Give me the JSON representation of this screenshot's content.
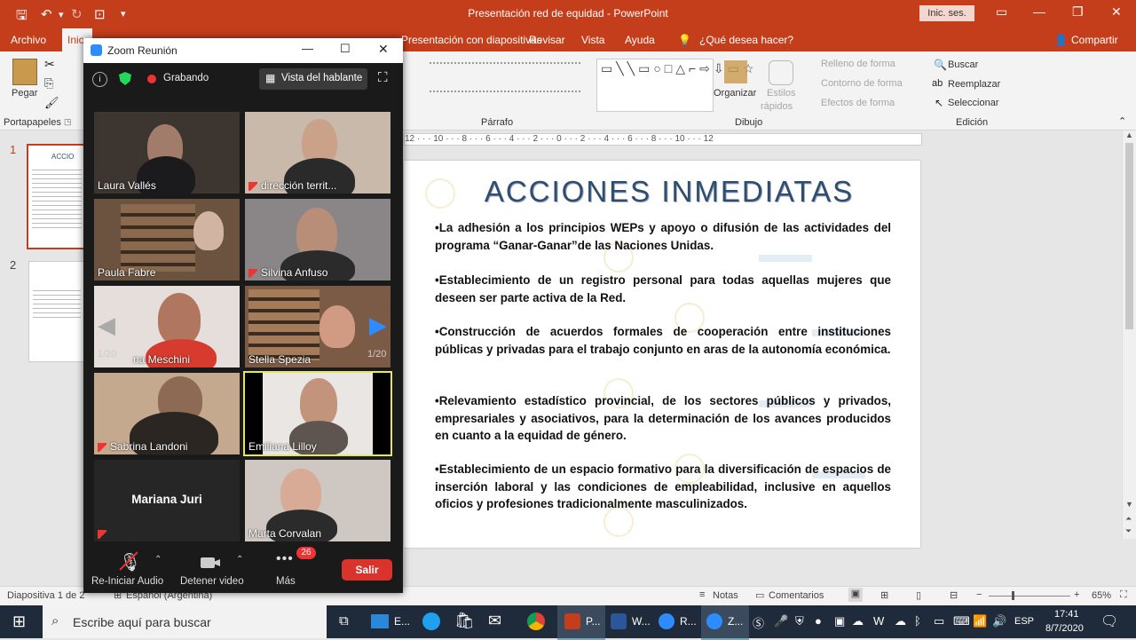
{
  "titlebar": {
    "title": "Presentación red de equidad  -  PowerPoint",
    "signin": "Inic. ses."
  },
  "tabs": [
    "Archivo",
    "Inic",
    "Presentación con diapositivas",
    "Revisar",
    "Vista",
    "Ayuda",
    "¿Qué desea hacer?",
    "Compartir"
  ],
  "ribbon": {
    "paste": "Pegar",
    "portapapeles": "Portapapeles",
    "parrafo": "Párrafo",
    "dibujo": "Dibujo",
    "edicion": "Edición",
    "organizar": "Organizar",
    "estilos1": "Estilos",
    "estilos2": "rápidos",
    "relleno": "Relleno de forma",
    "contorno": "Contorno de forma",
    "efectos": "Efectos de forma",
    "buscar": "Buscar",
    "reemplazar": "Reemplazar",
    "seleccionar": "Seleccionar"
  },
  "ruler": "12 · · · 10 · · · 8 · · · 6 · · · 4 · · · 2 · · · 0 · · · 2 · · · 4 · · · 6 · · · 8 · · · 10 · · · 12",
  "thumbs": {
    "n1": "1",
    "n2": "2",
    "t1": "ACCIO"
  },
  "slide": {
    "title": "ACCIONES INMEDIATAS",
    "bullets": [
      "•La adhesión a los principios WEPs y apoyo o difusión de las actividades del programa “Ganar-Ganar”de las Naciones Unidas.",
      "•Establecimiento de un registro personal para todas aquellas mujeres que deseen ser parte activa de la Red.",
      "•Construcción de acuerdos formales de cooperación entre instituciones públicas y privadas para el trabajo conjunto en aras de la autonomía económica.",
      "•Relevamiento estadístico provincial, de los sectores públicos y privados, empresariales y asociativos, para la determinación de los avances producidos en cuanto a la equidad de género.",
      "•Establecimiento de un espacio formativo para la diversificación de espacios de inserción laboral y las condiciones de empleabilidad, inclusive en aquellos oficios y profesiones tradicionalmente masculinizados."
    ]
  },
  "status": {
    "slide": "Diapositiva 1 de 2",
    "lang": "Español (Argentina)",
    "notes": "Notas",
    "comments": "Comentarios",
    "zoom": "65%"
  },
  "zoom": {
    "title": "Zoom Reunión",
    "recording": "Grabando",
    "speaker_view": "Vista del hablante",
    "page_left": "1/20",
    "page_right": "1/20",
    "participants": [
      {
        "name": "Laura Vallés",
        "muted": false
      },
      {
        "name": "dirección territ...",
        "muted": true
      },
      {
        "name": "Paula Fabre",
        "muted": false
      },
      {
        "name": "Silvina Anfuso",
        "muted": true
      },
      {
        "name": "na Meschini",
        "muted": false
      },
      {
        "name": "Stella Spezia",
        "muted": false
      },
      {
        "name": "Sabrina Landoni",
        "muted": true
      },
      {
        "name": "Emiliana Lilloy",
        "muted": false
      },
      {
        "name": "Mariana Juri",
        "muted": true
      },
      {
        "name": "Marta Corvalan",
        "muted": false
      }
    ],
    "controls": {
      "audio": "Re-Iniciar Audio",
      "video": "Detener video",
      "more": "Más",
      "badge": "26",
      "leave": "Salir"
    }
  },
  "taskbar": {
    "search": "Escribe aquí para buscar",
    "items": [
      "E...",
      "P...",
      "W...",
      "R...",
      "Z..."
    ],
    "lang": "ESP",
    "time": "17:41",
    "date": "8/7/2020"
  }
}
